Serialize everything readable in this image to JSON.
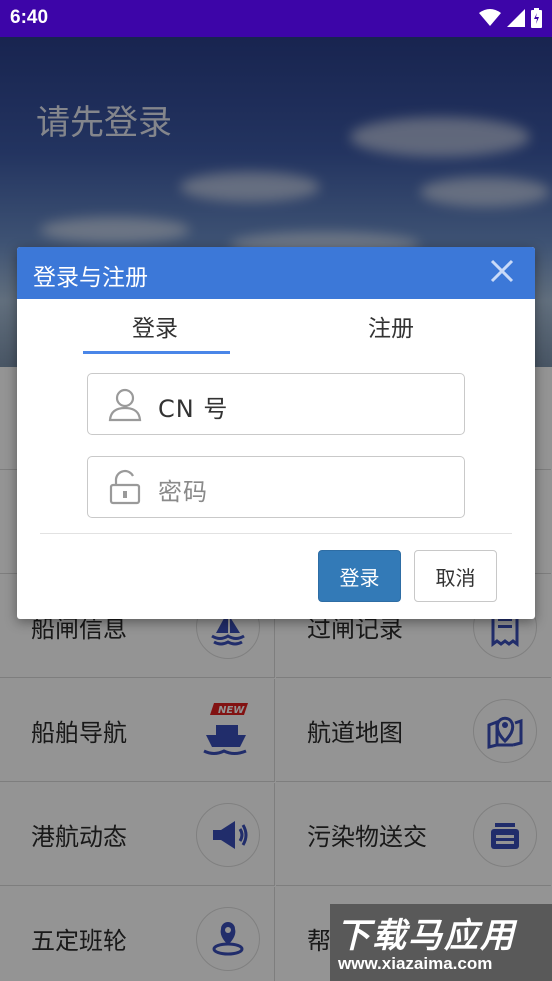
{
  "status_bar": {
    "time": "6:40"
  },
  "banner": {
    "title": "请先登录"
  },
  "grid": {
    "items": [
      {
        "label": "",
        "icon": ""
      },
      {
        "label": "",
        "icon": ""
      },
      {
        "label": "船闸信息",
        "icon": "sailboat-icon"
      },
      {
        "label": "过闸记录",
        "icon": "receipt-icon"
      },
      {
        "label": "船舶导航",
        "icon": "ship-new-icon"
      },
      {
        "label": "航道地图",
        "icon": "map-pin-icon"
      },
      {
        "label": "港航动态",
        "icon": "megaphone-icon"
      },
      {
        "label": "污染物送交",
        "icon": "tray-icon"
      },
      {
        "label": "五定班轮",
        "icon": "location-icon"
      },
      {
        "label": "帮",
        "icon": ""
      }
    ]
  },
  "dialog": {
    "title": "登录与注册",
    "tabs": {
      "login": "登录",
      "register": "注册"
    },
    "cn_field": {
      "value": "CN 号"
    },
    "password_field": {
      "placeholder": "密码"
    },
    "login_button": "登录",
    "cancel_button": "取消"
  },
  "watermark": {
    "big": "下载马应用",
    "small": "www.xiazaima.com"
  },
  "colors": {
    "status_bar": "#3d05a8",
    "dialog_header": "#3c78d8",
    "primary_button": "#337ab7",
    "icon_blue": "#3a4fb8"
  }
}
